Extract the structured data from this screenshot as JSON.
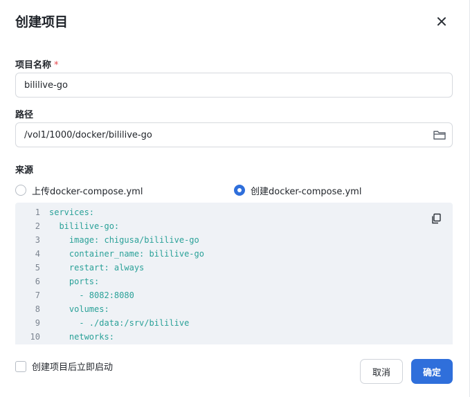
{
  "dialog": {
    "title": "创建项目",
    "close_icon": "close-icon"
  },
  "fields": {
    "name_label": "项目名称",
    "name_required": "*",
    "name_value": "bililive-go",
    "path_label": "路径",
    "path_value": "/vol1/1000/docker/bililive-go",
    "folder_icon": "folder-icon",
    "source_label": "来源"
  },
  "source_options": [
    {
      "label": "上传docker-compose.yml",
      "selected": false
    },
    {
      "label": "创建docker-compose.yml",
      "selected": true
    }
  ],
  "editor": {
    "copy_icon": "copy-icon",
    "lines": [
      {
        "n": "1",
        "text": "services:"
      },
      {
        "n": "2",
        "text": "  bililive-go:"
      },
      {
        "n": "3",
        "text": "    image: chigusa/bililive-go"
      },
      {
        "n": "4",
        "text": "    container_name: bililive-go"
      },
      {
        "n": "5",
        "text": "    restart: always"
      },
      {
        "n": "6",
        "text": "    ports:"
      },
      {
        "n": "7",
        "text": "      - 8082:8080"
      },
      {
        "n": "8",
        "text": "    volumes:"
      },
      {
        "n": "9",
        "text": "      - ./data:/srv/bililive"
      },
      {
        "n": "10",
        "text": "    networks:"
      }
    ]
  },
  "footer": {
    "autostart_label": "创建项目后立即启动",
    "autostart_checked": false,
    "cancel_label": "取消",
    "ok_label": "确定"
  },
  "colors": {
    "accent": "#2f6fdb",
    "editor_bg": "#eff2f6",
    "code_text": "#2aa198",
    "required": "#e5484d"
  }
}
